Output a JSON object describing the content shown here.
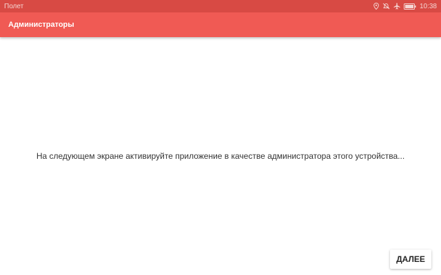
{
  "status_bar": {
    "carrier": "Полет",
    "time": "10:38",
    "icons": [
      "location-icon",
      "do-not-disturb-icon",
      "airplane-mode-icon",
      "battery-icon"
    ]
  },
  "app_bar": {
    "title": "Администраторы"
  },
  "main": {
    "message": "На следующем экране активируйте приложение в качестве администратора этого устройства..."
  },
  "footer": {
    "next_label": "ДАЛЕЕ"
  },
  "colors": {
    "status_bar": "#d84a44",
    "app_bar": "#f05a54",
    "text": "#333333",
    "background": "#ffffff"
  }
}
